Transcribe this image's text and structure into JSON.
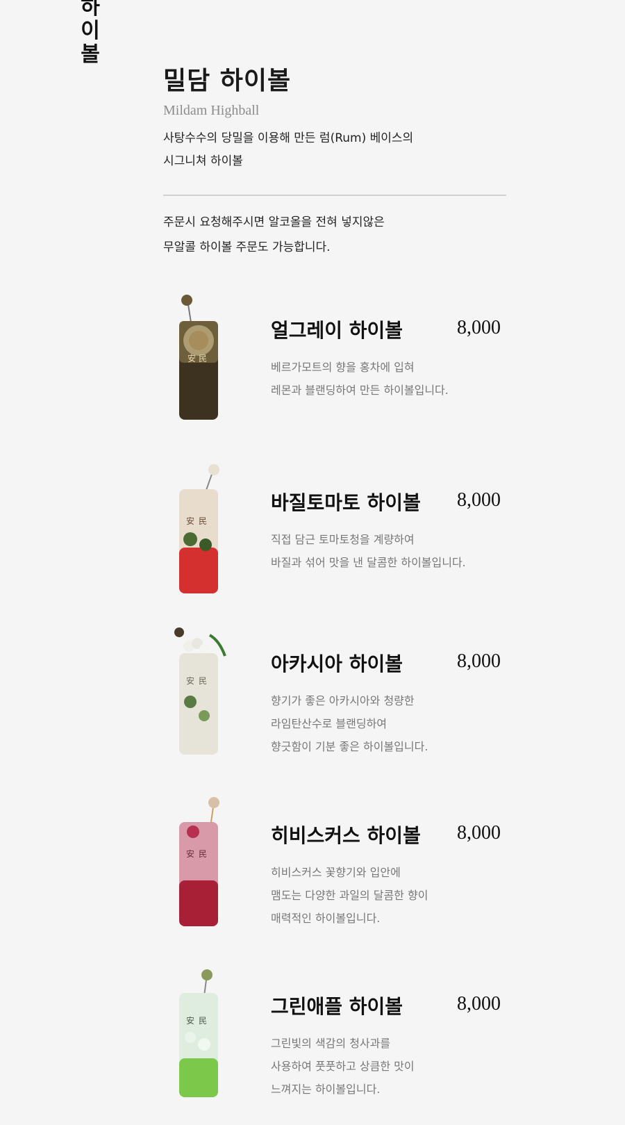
{
  "vertical_title": [
    "하",
    "이",
    "볼"
  ],
  "header": {
    "title_ko": "밀담 하이볼",
    "title_en": "Mildam Highball",
    "desc": [
      "사탕수수의 당밀을 이용해 만든 럼(Rum) 베이스의",
      "시그니쳐 하이볼"
    ]
  },
  "notice": [
    "주문시 요청해주시면 알코올을 전혀 넣지않은",
    "무알콜 하이볼 주문도 가능합니다."
  ],
  "items": [
    {
      "name": "얼그레이 하이볼",
      "price": "8,000",
      "desc": [
        "베르가모트의 향을 홍차에 입혀",
        "레몬과 블랜딩하여 만든 하이볼입니다."
      ],
      "color": "#5a4a2a"
    },
    {
      "name": "바질토마토 하이볼",
      "price": "8,000",
      "desc": [
        "직접 담근 토마토청을 계량하여",
        "바질과 섞어 맛을 낸 달콤한 하이볼입니다."
      ],
      "color": "#c8383a"
    },
    {
      "name": "아카시아 하이볼",
      "price": "8,000",
      "desc": [
        "향기가 좋은 아카시아와 청량한",
        "라임탄산수로 블랜딩하여",
        "향긋함이 기분 좋은 하이볼입니다."
      ],
      "color": "#dcdcc8"
    },
    {
      "name": "히비스커스 하이볼",
      "price": "8,000",
      "desc": [
        "히비스커스 꽃향기와 입안에",
        "맴도는 다양한 과일의 달콤한 향이",
        "매력적인 하이볼입니다."
      ],
      "color": "#a8203c"
    },
    {
      "name": "그린애플 하이볼",
      "price": "8,000",
      "desc": [
        "그린빛의 색감의 청사과를",
        "사용하여 풋풋하고 상큼한 맛이",
        "느껴지는 하이볼입니다."
      ],
      "color": "#8cc850"
    }
  ]
}
